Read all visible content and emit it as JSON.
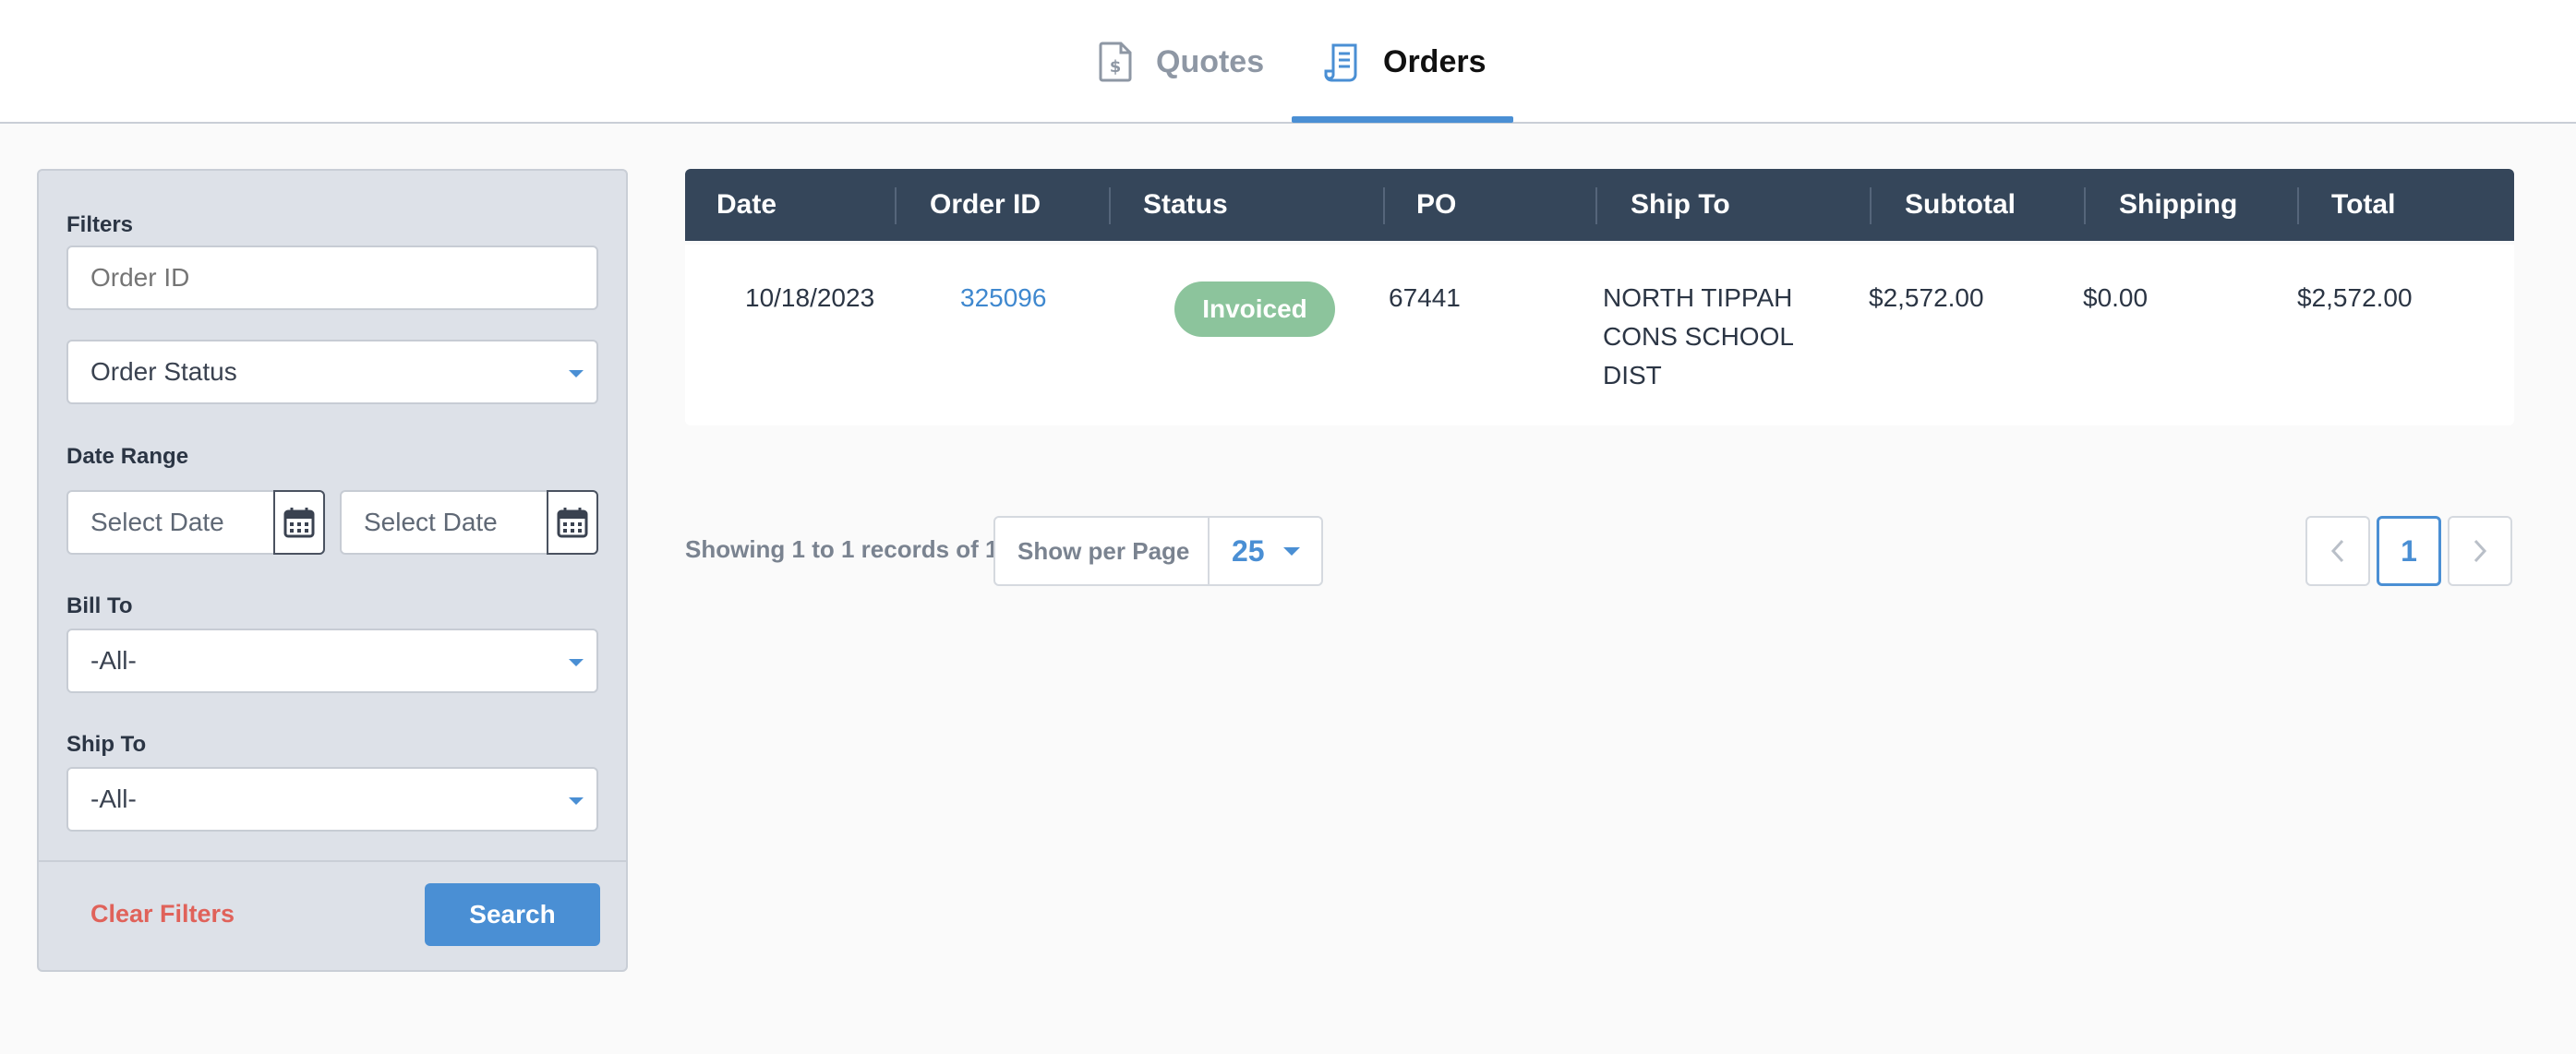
{
  "tabs": [
    {
      "label": "Quotes",
      "icon": "invoice-dollar-icon",
      "active": false
    },
    {
      "label": "Orders",
      "icon": "receipt-icon",
      "active": true
    }
  ],
  "filters": {
    "title": "Filters",
    "order_id_placeholder": "Order ID",
    "order_status_label": "Order Status",
    "date_range_label": "Date Range",
    "date_from_placeholder": "Select Date",
    "date_to_placeholder": "Select Date",
    "bill_to_label": "Bill To",
    "bill_to_value": "-All-",
    "ship_to_label": "Ship To",
    "ship_to_value": "-All-",
    "clear_label": "Clear Filters",
    "search_label": "Search"
  },
  "table": {
    "columns": [
      "Date",
      "Order ID",
      "Status",
      "PO",
      "Ship To",
      "Subtotal",
      "Shipping",
      "Total"
    ],
    "rows": [
      {
        "date": "10/18/2023",
        "order_id": "325096",
        "status": "Invoiced",
        "po": "67441",
        "ship_to_lines": [
          "NORTH TIPPAH",
          "CONS SCHOOL",
          "DIST"
        ],
        "subtotal": "$2,572.00",
        "shipping": "$0.00",
        "total": "$2,572.00"
      }
    ]
  },
  "pagination": {
    "showing_text": "Showing 1 to 1 records of 1",
    "per_page_label": "Show per Page",
    "per_page_value": "25",
    "current_page": "1"
  },
  "colors": {
    "accent": "#4a8fd4",
    "header_bg": "#35465a",
    "status_invoiced": "#8cc49c",
    "clear_filters": "#e0625a"
  }
}
